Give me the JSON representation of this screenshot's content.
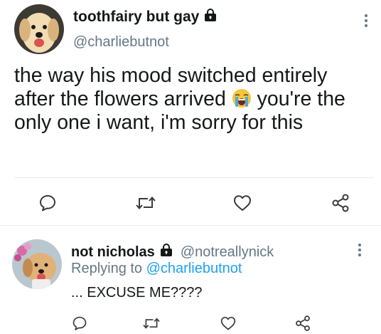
{
  "tweet": {
    "author": {
      "display_name": "toothfairy but gay",
      "handle": "@charliebutnot",
      "avatar": "golden-retriever-avatar",
      "protected_icon": "lock-icon"
    },
    "text_line1": "the way his mood switched entirely",
    "text_line2_before": "after the flowers arrived",
    "text_line2_emoji": "loudly-crying-face-emoji",
    "text_line2_after": " you're the",
    "text_line3": "only one i want, i'm sorry for this",
    "actions": [
      "reply-icon",
      "retweet-icon",
      "like-icon",
      "share-icon"
    ]
  },
  "reply": {
    "author": {
      "display_name": "not nicholas",
      "handle": "@notreallynick",
      "avatar": "dog-with-flowers-avatar",
      "protected_icon": "lock-icon"
    },
    "replying_prefix": "Replying to ",
    "replying_to": "@charliebutnot",
    "text": "... EXCUSE ME????",
    "actions": [
      "reply-icon",
      "retweet-icon",
      "like-icon",
      "share-icon"
    ]
  },
  "colors": {
    "text": "#14171a",
    "secondary": "#657786",
    "link": "#1da1f2",
    "divider": "#e6ecf0"
  }
}
